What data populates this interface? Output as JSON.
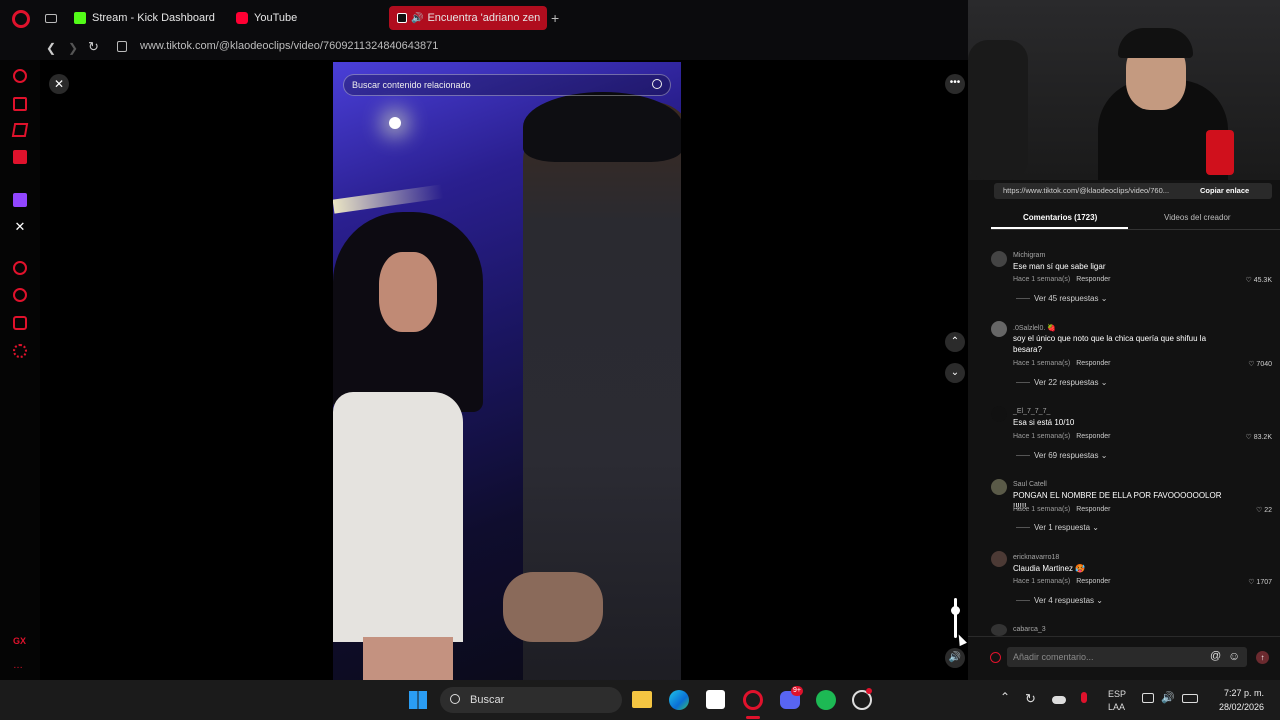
{
  "browser": {
    "tabs": [
      {
        "label": "Stream - Kick Dashboard",
        "color": "#53fc18"
      },
      {
        "label": "YouTube",
        "color": "#ff0033"
      },
      {
        "label": "Encuentra 'adriano zen",
        "color": "#ffffff",
        "active": true
      }
    ],
    "new_tab_label": "+",
    "url": "www.tiktok.com/@klaodeoclips/video/7609211324840643871"
  },
  "video": {
    "search_placeholder": "Buscar contenido relacionado"
  },
  "link_box": {
    "url": "https://www.tiktok.com/@klaodeoclips/video/760...",
    "copy_label": "Copiar enlace"
  },
  "panel_tabs": {
    "comments": "Comentarios (1723)",
    "creator_videos": "Videos del creador"
  },
  "comments": [
    {
      "user": "Michigram",
      "text": "Ese man sí que sabe ligar",
      "time": "Hace 1 semana(s)",
      "reply": "Responder",
      "likes": "45.3K",
      "replies": "Ver 45 respuestas"
    },
    {
      "user": ".0Salzlel0. 🍓",
      "text": "soy el único que noto que la chica quería que shifuu la besara?",
      "time": "Hace 1 semana(s)",
      "reply": "Responder",
      "likes": "7040",
      "replies": "Ver 22 respuestas"
    },
    {
      "user": "_El_7_7_7_",
      "text": "Esa si está 10/10",
      "time": "Hace 1 semana(s)",
      "reply": "Responder",
      "likes": "83.2K",
      "replies": "Ver 69 respuestas"
    },
    {
      "user": "Saul Catell",
      "text": "PONGAN EL NOMBRE DE ELLA POR FAVOOOOOOLOR !!!!!!",
      "time": "Hace 1 semana(s)",
      "reply": "Responder",
      "likes": "22",
      "replies": "Ver 1 respuesta"
    },
    {
      "user": "ericknavarro18",
      "text": "Claudia Martinez 🥵",
      "time": "Hace 1 semana(s)",
      "reply": "Responder",
      "likes": "1707",
      "replies": "Ver 4 respuestas"
    },
    {
      "user": "cabarca_3",
      "text": "",
      "time": "",
      "reply": "",
      "likes": "",
      "replies": ""
    }
  ],
  "comment_input": {
    "placeholder": "Añadir comentario...",
    "mention_symbol": "@",
    "emoji_symbol": "☺"
  },
  "taskbar": {
    "search_label": "Buscar",
    "lang_top": "ESP",
    "lang_bottom": "LAA",
    "time": "7:27 p. m.",
    "date": "28/02/2026",
    "discord_badge": "9+"
  },
  "sidebar_bottom": "GX",
  "colors": {
    "accent_red": "#e0122c",
    "tab_active": "#b00d1e",
    "kick_green": "#53fc18",
    "youtube_red": "#ff0033"
  }
}
